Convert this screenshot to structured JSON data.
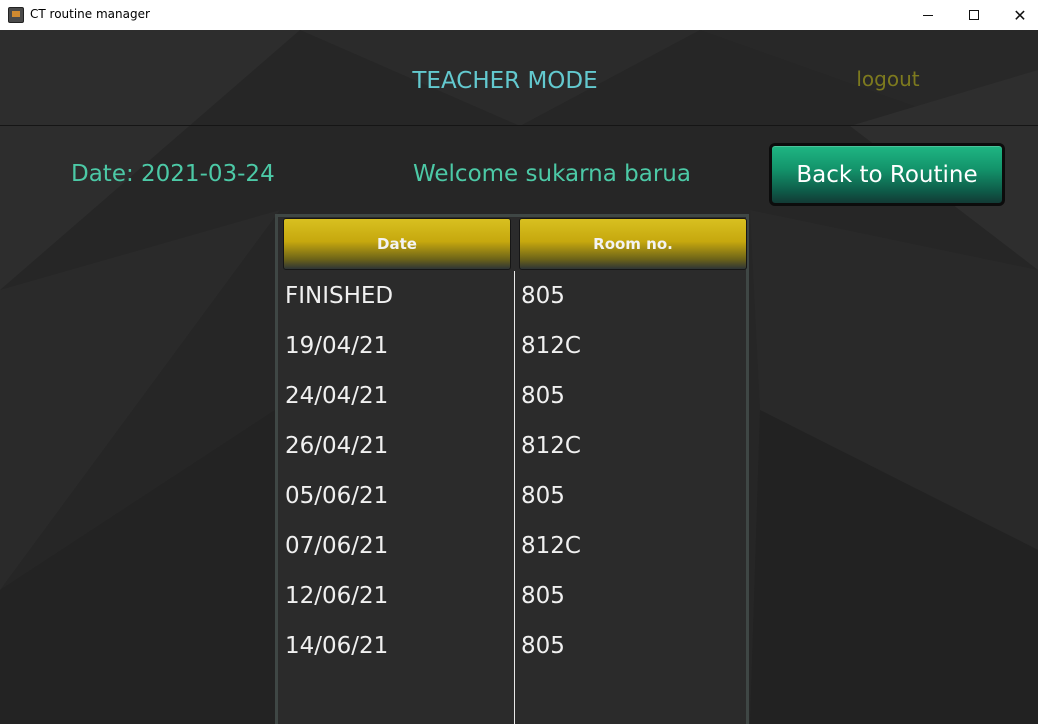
{
  "window": {
    "title": "CT routine manager",
    "controls": {
      "minimize": "minimize",
      "maximize": "maximize",
      "close": "✕"
    }
  },
  "header": {
    "mode_title": "TEACHER MODE",
    "logout_label": "logout"
  },
  "info": {
    "date_label": "Date: 2021-03-24",
    "welcome_text": "Welcome sukarna barua"
  },
  "back_button_label": "Back to Routine",
  "table": {
    "columns": [
      "Date",
      "Room no."
    ],
    "rows": [
      {
        "date": "FINISHED",
        "room": "805"
      },
      {
        "date": "19/04/21",
        "room": "812C"
      },
      {
        "date": "24/04/21",
        "room": "805"
      },
      {
        "date": "26/04/21",
        "room": "812C"
      },
      {
        "date": "05/06/21",
        "room": "805"
      },
      {
        "date": "07/06/21",
        "room": "812C"
      },
      {
        "date": "12/06/21",
        "room": "805"
      },
      {
        "date": "14/06/21",
        "room": "805"
      }
    ]
  },
  "colors": {
    "accent_teal": "#4cc9a6",
    "mode_title": "#63c9cf",
    "logout": "#7d7a1e",
    "header_gold": "#c6a80e",
    "button_green": "#13946b"
  }
}
